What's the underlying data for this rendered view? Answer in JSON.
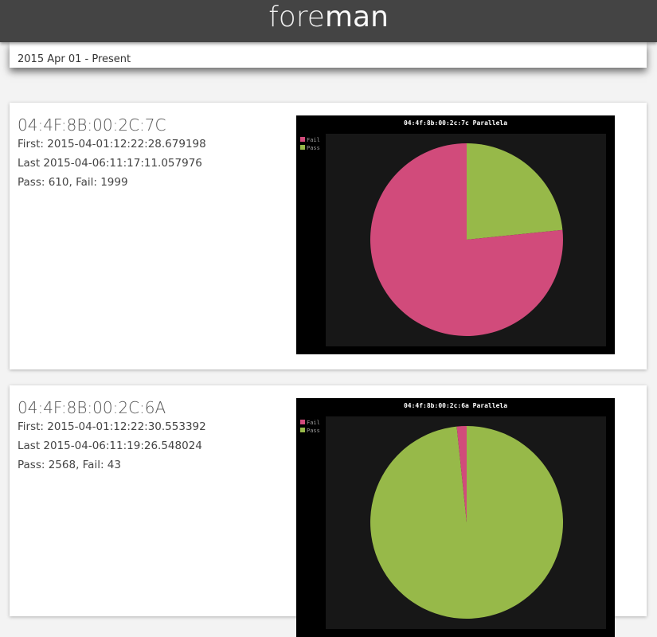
{
  "header": {
    "brand_part1": "fore",
    "brand_part2": "man"
  },
  "date_range": "2015 Apr 01 - Present",
  "devices": [
    {
      "id": "04:4F:8B:00:2C:7C",
      "first": "First: 2015-04-01:12:22:28.679198",
      "last": "Last 2015-04-06:11:17:11.057976",
      "pass_fail": "Pass: 610, Fail: 1999"
    },
    {
      "id": "04:4F:8B:00:2C:6A",
      "first": "First: 2015-04-01:12:22:30.553392",
      "last": "Last 2015-04-06:11:19:26.548024",
      "pass_fail": "Pass: 2568, Fail: 43"
    }
  ],
  "chart_data": [
    {
      "type": "pie",
      "title": "04:4f:8b:00:2c:7c Parallela",
      "categories": [
        "Fail",
        "Pass"
      ],
      "values": [
        1999,
        610
      ],
      "colors": [
        "#d14b7b",
        "#97b949"
      ],
      "legend": "top-left"
    },
    {
      "type": "pie",
      "title": "04:4f:8b:00:2c:6a Parallela",
      "categories": [
        "Fail",
        "Pass"
      ],
      "values": [
        43,
        2568
      ],
      "colors": [
        "#d14b7b",
        "#97b949"
      ],
      "legend": "top-left"
    }
  ]
}
